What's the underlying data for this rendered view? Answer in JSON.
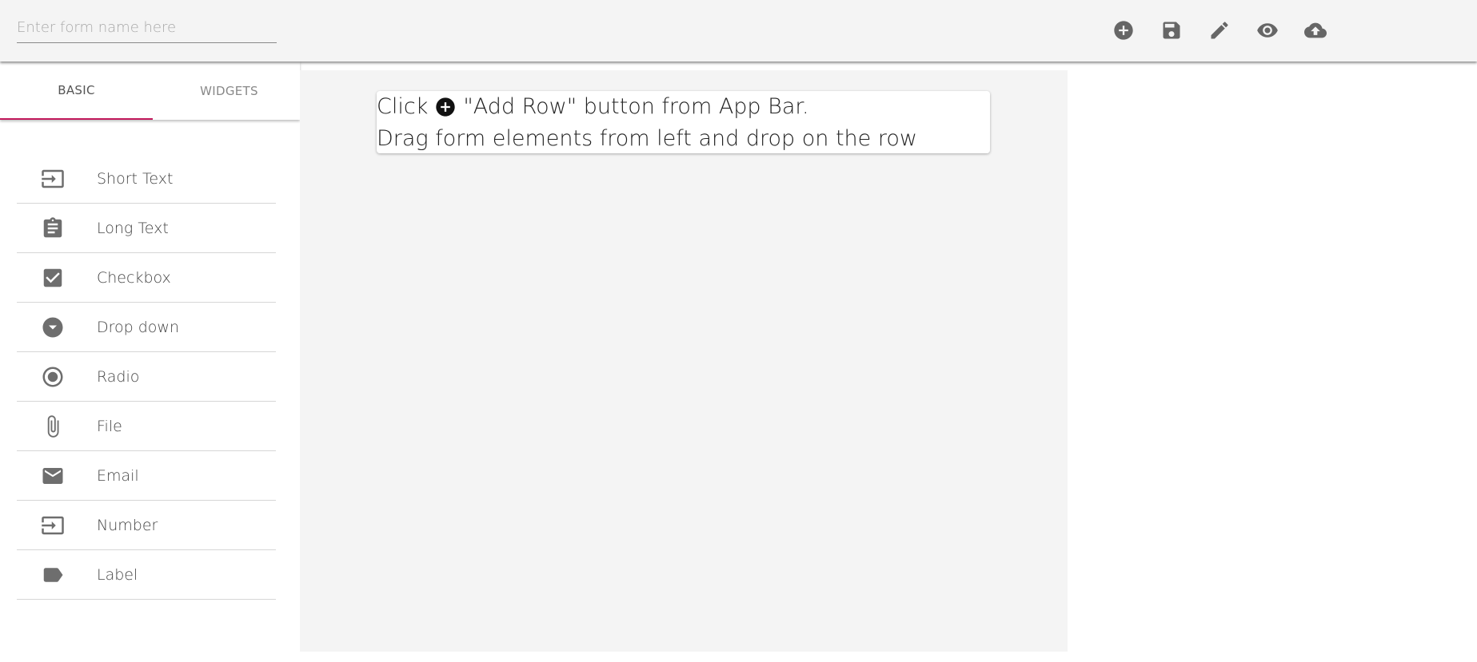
{
  "form": {
    "name_placeholder": "Enter form name here",
    "name_value": ""
  },
  "toolbar": {
    "buttons": [
      {
        "name": "add-row",
        "icon": "add-circle-icon"
      },
      {
        "name": "save",
        "icon": "save-icon"
      },
      {
        "name": "edit",
        "icon": "pencil-icon"
      },
      {
        "name": "preview",
        "icon": "eye-icon"
      },
      {
        "name": "upload",
        "icon": "cloud-upload-icon"
      }
    ]
  },
  "tabs": [
    {
      "label": "BASIC",
      "active": true
    },
    {
      "label": "WIDGETS",
      "active": false
    }
  ],
  "elements": [
    {
      "label": "Short Text",
      "icon": "input-icon"
    },
    {
      "label": "Long Text",
      "icon": "clipboard-icon"
    },
    {
      "label": "Checkbox",
      "icon": "checkbox-icon"
    },
    {
      "label": "Drop down",
      "icon": "dropdown-circle-icon"
    },
    {
      "label": "Radio",
      "icon": "radio-icon"
    },
    {
      "label": "File",
      "icon": "paperclip-icon"
    },
    {
      "label": "Email",
      "icon": "mail-icon"
    },
    {
      "label": "Number",
      "icon": "input-icon"
    },
    {
      "label": "Label",
      "icon": "label-tag-icon"
    }
  ],
  "hint": {
    "line1_prefix": "Click",
    "line1_suffix": "\"Add Row\" button from App Bar.",
    "line2": "Drag form elements from left and drop on the row"
  },
  "colors": {
    "accent": "#c2185b",
    "icon": "#6e6e6e",
    "appbar": "#f4f4f4",
    "canvas": "#f4f4f4"
  }
}
